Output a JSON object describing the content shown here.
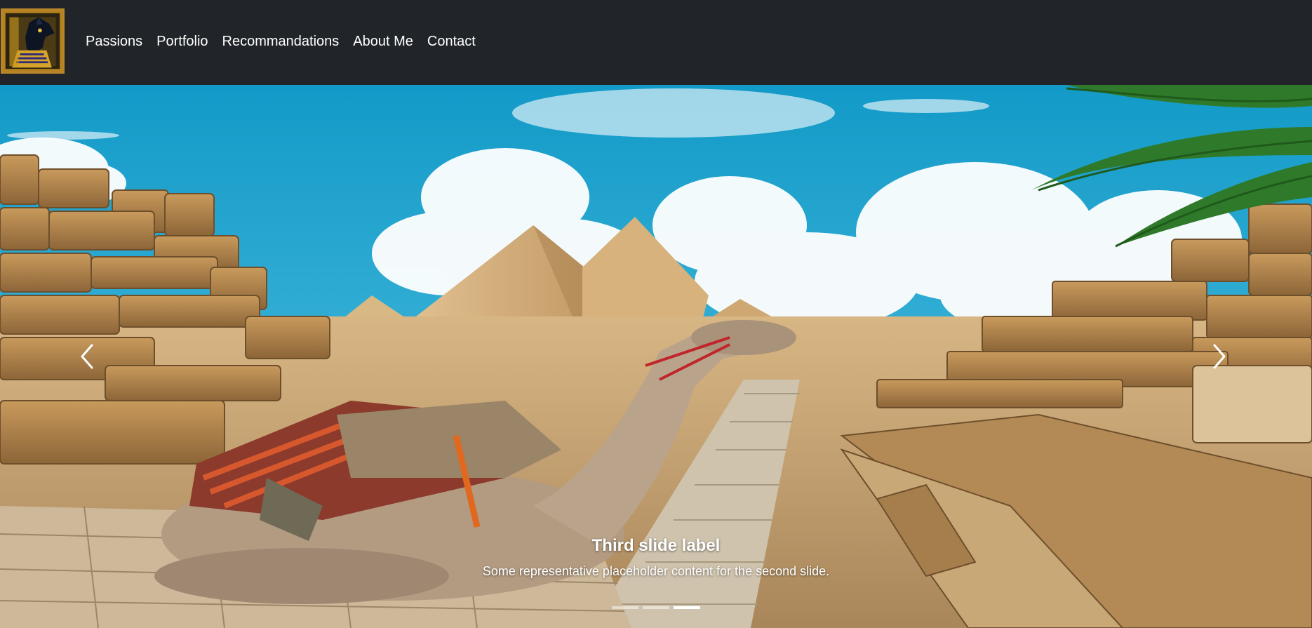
{
  "navbar": {
    "logo_icon": "anubis-logo-icon",
    "links": [
      {
        "label": "Passions"
      },
      {
        "label": "Portfolio"
      },
      {
        "label": "Recommandations"
      },
      {
        "label": "About Me"
      },
      {
        "label": "Contact"
      }
    ]
  },
  "carousel": {
    "image": "pyramids-camel-photo",
    "caption": {
      "title": "Third slide label",
      "text": "Some representative placeholder content for the second slide."
    },
    "prev_icon": "chevron-left-icon",
    "next_icon": "chevron-right-icon",
    "slides_total": 3,
    "active_slide": 3
  },
  "colors": {
    "navbar_bg": "#212529",
    "nav_text": "#ffffff",
    "sky": "#1ea4cf",
    "sand": "#d9b27a"
  }
}
